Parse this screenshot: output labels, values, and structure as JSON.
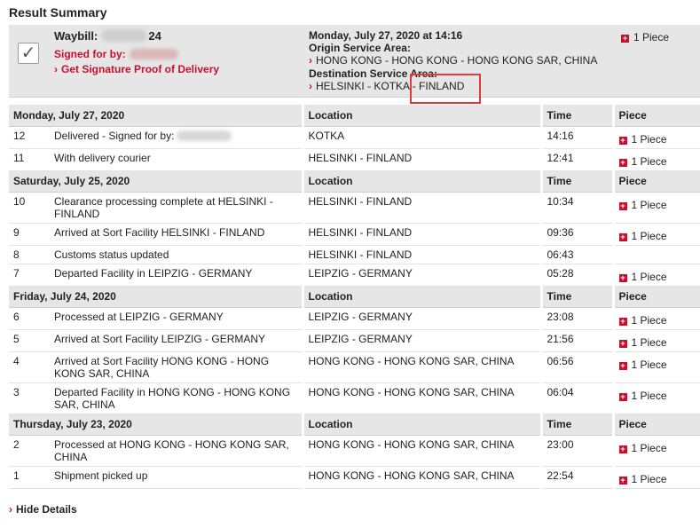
{
  "title": "Result Summary",
  "summary": {
    "waybill_label": "Waybill:",
    "waybill_prefix": "",
    "waybill_suffix": "24",
    "signed_for_label": "Signed for by:",
    "proof_link": "Get Signature Proof of Delivery",
    "date_time": "Monday, July 27, 2020 at 14:16",
    "origin_label": "Origin Service Area:",
    "origin_value": "HONG KONG - HONG KONG - HONG KONG SAR, CHINA",
    "destination_label": "Destination Service Area:",
    "destination_value": "HELSINKI - KOTKA - FINLAND",
    "piece": "1 Piece"
  },
  "columns": {
    "location": "Location",
    "time": "Time",
    "piece": "Piece"
  },
  "days": [
    {
      "date": "Monday, July 27, 2020",
      "events": [
        {
          "num": "12",
          "desc": "Delivered - Signed for by:",
          "location": "KOTKA",
          "time": "14:16",
          "piece": "1 Piece",
          "blurred": true
        },
        {
          "num": "11",
          "desc": "With delivery courier",
          "location": "HELSINKI - FINLAND",
          "time": "12:41",
          "piece": "1 Piece"
        }
      ]
    },
    {
      "date": "Saturday, July 25, 2020",
      "events": [
        {
          "num": "10",
          "desc": "Clearance processing complete at HELSINKI - FINLAND",
          "location": "HELSINKI - FINLAND",
          "time": "10:34",
          "piece": "1 Piece"
        },
        {
          "num": "9",
          "desc": "Arrived at Sort Facility HELSINKI - FINLAND",
          "location": "HELSINKI - FINLAND",
          "time": "09:36",
          "piece": "1 Piece"
        },
        {
          "num": "8",
          "desc": "Customs status updated",
          "location": "HELSINKI - FINLAND",
          "time": "06:43",
          "piece": ""
        },
        {
          "num": "7",
          "desc": "Departed Facility in LEIPZIG - GERMANY",
          "location": "LEIPZIG - GERMANY",
          "time": "05:28",
          "piece": "1 Piece"
        }
      ]
    },
    {
      "date": "Friday, July 24, 2020",
      "events": [
        {
          "num": "6",
          "desc": "Processed at LEIPZIG - GERMANY",
          "location": "LEIPZIG - GERMANY",
          "time": "23:08",
          "piece": "1 Piece"
        },
        {
          "num": "5",
          "desc": "Arrived at Sort Facility LEIPZIG - GERMANY",
          "location": "LEIPZIG - GERMANY",
          "time": "21:56",
          "piece": "1 Piece"
        },
        {
          "num": "4",
          "desc": "Arrived at Sort Facility HONG KONG - HONG KONG SAR, CHINA",
          "location": "HONG KONG - HONG KONG SAR, CHINA",
          "time": "06:56",
          "piece": "1 Piece"
        },
        {
          "num": "3",
          "desc": "Departed Facility in HONG KONG - HONG KONG SAR, CHINA",
          "location": "HONG KONG - HONG KONG SAR, CHINA",
          "time": "06:04",
          "piece": "1 Piece"
        }
      ]
    },
    {
      "date": "Thursday, July 23, 2020",
      "events": [
        {
          "num": "2",
          "desc": "Processed at HONG KONG - HONG KONG SAR, CHINA",
          "location": "HONG KONG - HONG KONG SAR, CHINA",
          "time": "23:00",
          "piece": "1 Piece"
        },
        {
          "num": "1",
          "desc": "Shipment picked up",
          "location": "HONG KONG - HONG KONG SAR, CHINA",
          "time": "22:54",
          "piece": "1 Piece"
        }
      ]
    }
  ],
  "hide_details": "Hide Details",
  "colors": {
    "accent_red": "#c8102e",
    "header_gray": "#e6e6e6",
    "highlight_red": "#e03c3c"
  }
}
